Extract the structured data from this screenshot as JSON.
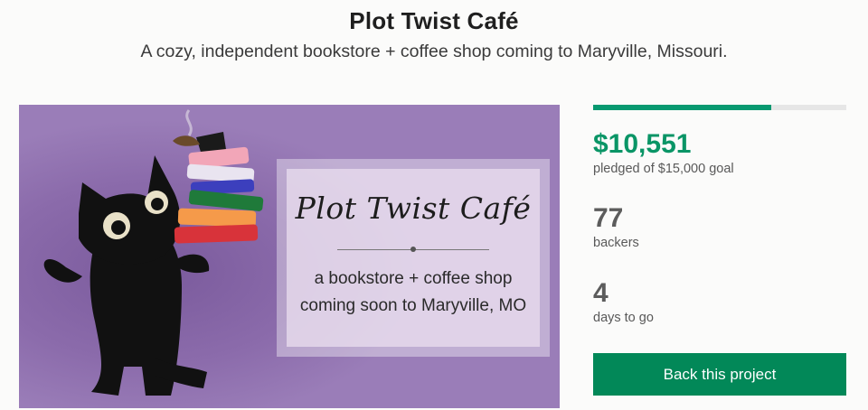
{
  "header": {
    "title": "Plot Twist Café",
    "subtitle": "A cozy, independent bookstore + coffee shop coming to Maryville, Missouri."
  },
  "hero": {
    "logo_text": "Plot Twist Café",
    "tagline_line1": "a bookstore + coffee shop",
    "tagline_line2": "coming soon to Maryville, MO",
    "illustration": "black-cat-carrying-books-and-coffee-mug"
  },
  "stats": {
    "progress_fraction": 0.703,
    "pledged_amount": "$10,551",
    "pledged_label": "pledged of $15,000 goal",
    "backers_count": "77",
    "backers_label": "backers",
    "days_count": "4",
    "days_label": "days to go"
  },
  "cta": {
    "back_label": "Back this project"
  },
  "colors": {
    "accent_green": "#079970",
    "button_green": "#028858",
    "hero_purple": "#9a7db8"
  }
}
